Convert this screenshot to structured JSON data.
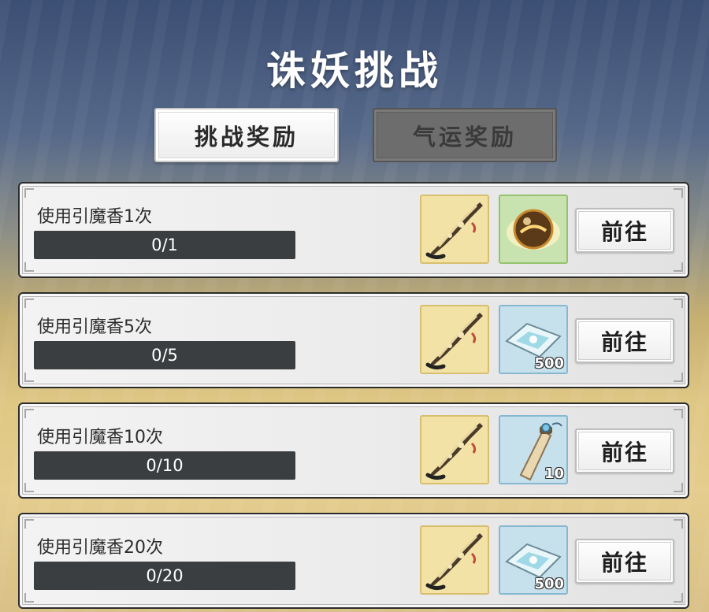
{
  "title": "诛妖挑战",
  "tabs": [
    {
      "label": "挑战奖励",
      "active": true
    },
    {
      "label": "气运奖励",
      "active": false
    }
  ],
  "tasks": [
    {
      "label": "使用引魔香1次",
      "progress_text": "0/1",
      "progress_fraction": 0,
      "rewards": [
        {
          "icon": "incense-icon"
        },
        {
          "icon": "fortune-orb-icon"
        }
      ],
      "button": "前往"
    },
    {
      "label": "使用引魔香5次",
      "progress_text": "0/5",
      "progress_fraction": 0,
      "rewards": [
        {
          "icon": "incense-icon"
        },
        {
          "icon": "crystal-cloth-icon",
          "qty": "500"
        }
      ],
      "button": "前往"
    },
    {
      "label": "使用引魔香10次",
      "progress_text": "0/10",
      "progress_fraction": 0,
      "rewards": [
        {
          "icon": "incense-icon"
        },
        {
          "icon": "scroll-icon",
          "qty": "10"
        }
      ],
      "button": "前往"
    },
    {
      "label": "使用引魔香20次",
      "progress_text": "0/20",
      "progress_fraction": 0,
      "rewards": [
        {
          "icon": "incense-icon"
        },
        {
          "icon": "crystal-cloth-icon",
          "qty": "500"
        }
      ],
      "button": "前往"
    }
  ],
  "colors": {
    "bar_bg": "#3b3e40",
    "slot_yellow": "#f3e2a6",
    "slot_green": "#c9e3b0",
    "slot_blue": "#c6e0ec"
  }
}
